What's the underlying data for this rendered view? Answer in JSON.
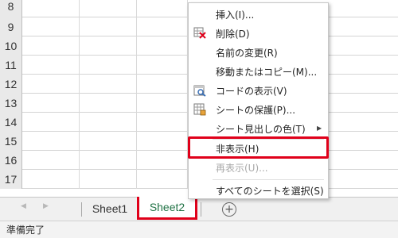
{
  "grid": {
    "row_numbers": [
      "8",
      "9",
      "10",
      "11",
      "12",
      "13",
      "14",
      "15",
      "16",
      "17"
    ]
  },
  "context_menu": {
    "items": [
      {
        "label": "挿入(I)...",
        "icon": "none",
        "enabled": true
      },
      {
        "label": "削除(D)",
        "icon": "delete-sheet-icon",
        "enabled": true
      },
      {
        "label": "名前の変更(R)",
        "icon": "none",
        "enabled": true
      },
      {
        "label": "移動またはコピー(M)...",
        "icon": "none",
        "enabled": true
      },
      {
        "label": "コードの表示(V)",
        "icon": "view-code-icon",
        "enabled": true
      },
      {
        "label": "シートの保護(P)...",
        "icon": "protect-sheet-icon",
        "enabled": true
      },
      {
        "label": "シート見出しの色(T)",
        "icon": "none",
        "enabled": true,
        "submenu": true
      },
      {
        "label": "非表示(H)",
        "icon": "none",
        "enabled": true,
        "highlighted": true
      },
      {
        "label": "再表示(U)...",
        "icon": "none",
        "enabled": false
      },
      {
        "label": "すべてのシートを選択(S)",
        "icon": "none",
        "enabled": true
      }
    ]
  },
  "tabs": [
    {
      "label": "Sheet1",
      "active": false
    },
    {
      "label": "Sheet2",
      "active": true
    }
  ],
  "add_sheet_label": "⊕",
  "status": {
    "text": "準備完了"
  },
  "colors": {
    "highlight_border": "#e0001a",
    "active_tab_text": "#217346",
    "row_header_bg": "#e9e9e9"
  }
}
